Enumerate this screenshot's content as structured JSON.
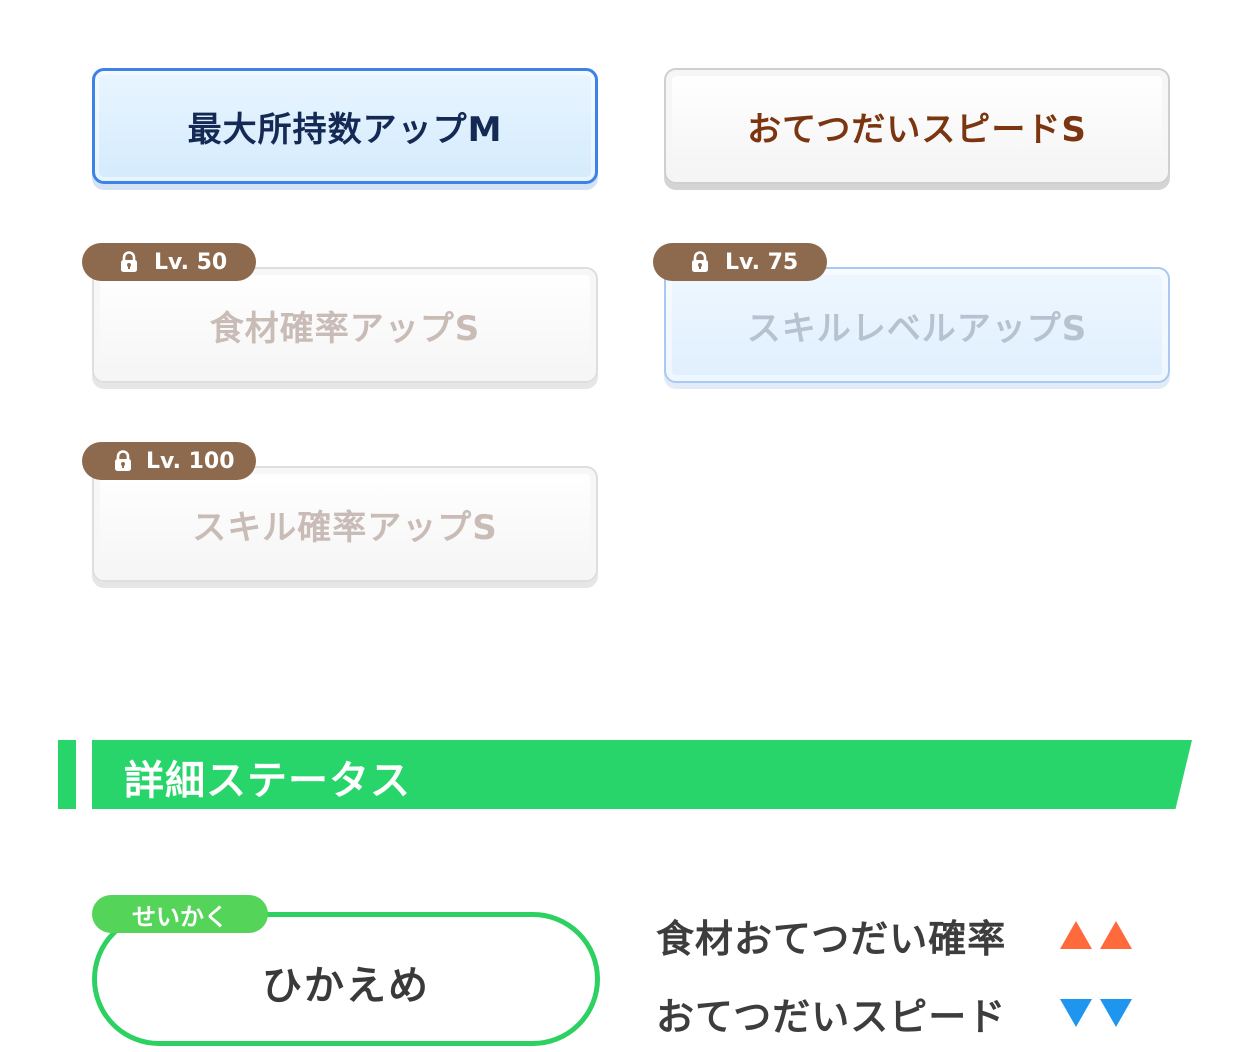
{
  "skills": [
    {
      "label": "最大所持数アップM",
      "state": "selected"
    },
    {
      "label": "おてつだいスピードS",
      "state": "unlocked"
    },
    {
      "label": "食材確率アップS",
      "state": "locked",
      "unlock_level": "Lv. 50"
    },
    {
      "label": "スキルレベルアップS",
      "state": "locked",
      "unlock_level": "Lv. 75"
    },
    {
      "label": "スキル確率アップS",
      "state": "locked",
      "unlock_level": "Lv. 100"
    }
  ],
  "section": {
    "title": "詳細ステータス"
  },
  "nature": {
    "label": "せいかく",
    "value": "ひかえめ"
  },
  "effects": [
    {
      "label": "食材おてつだい確率",
      "direction": "up",
      "color": "#ff6a3c",
      "icon": "triangle-up-icon"
    },
    {
      "label": "おてつだいスピード",
      "direction": "down",
      "color": "#1e96f0",
      "icon": "triangle-down-icon"
    }
  ],
  "colors": {
    "accent_green": "#27d56a",
    "badge_brown": "#8d6a4d",
    "selected_blue": "#3c82e8"
  }
}
